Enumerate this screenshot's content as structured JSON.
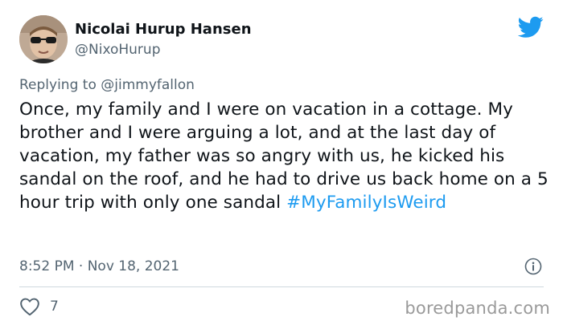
{
  "tweet": {
    "author": {
      "display_name": "Nicolai Hurup Hansen",
      "handle": "@NixoHurup",
      "avatar_icon": "user-avatar"
    },
    "reply_prefix": "Replying to",
    "reply_to": "@jimmyfallon",
    "text": "Once, my family and I were on vacation in a cottage. My brother and I were arguing a lot, and at the last day of vacation, my father was so angry with us, he kicked his sandal on the roof, and he had to drive us back home on a 5 hour trip with only one sandal",
    "hashtag": "#MyFamilyIsWeird",
    "timestamp": "8:52 PM · Nov 18, 2021",
    "likes": "7"
  },
  "icons": {
    "logo": "twitter-bird-icon",
    "info": "info-icon",
    "like": "heart-icon"
  },
  "watermark": "boredpanda.com",
  "colors": {
    "accent": "#1d9bf0",
    "text_primary": "#0f1419",
    "text_secondary": "#536471",
    "divider": "#cfd9de",
    "watermark": "#9a9a9a"
  }
}
